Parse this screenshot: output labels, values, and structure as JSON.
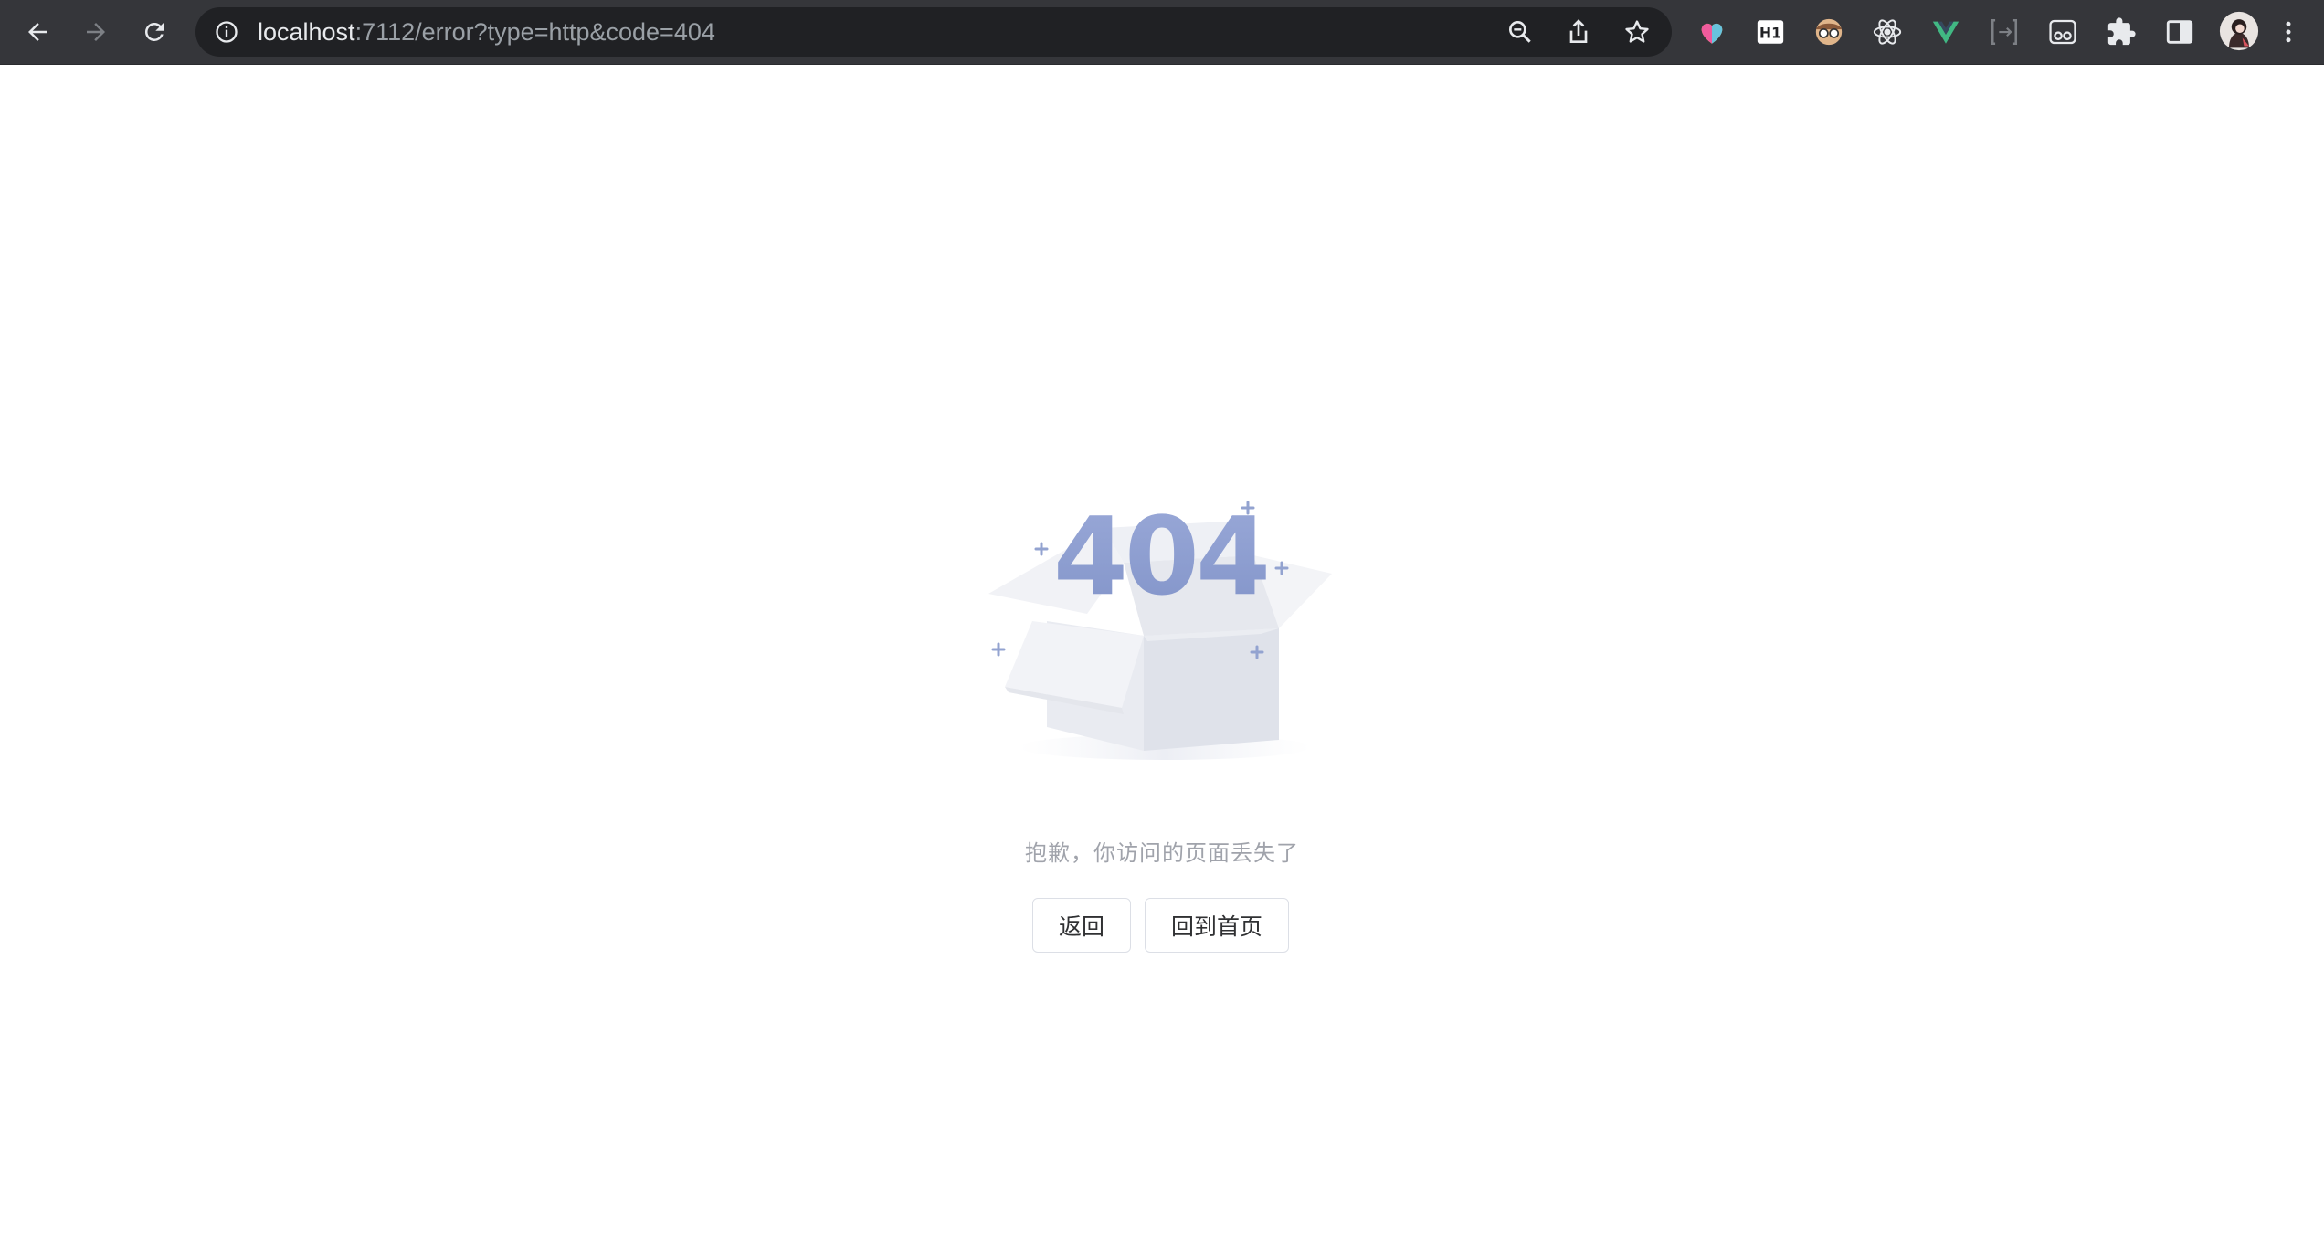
{
  "browser": {
    "url_host": "localhost",
    "url_rest": ":7112/error?type=http&code=404",
    "extensions": [
      "colorful-heart-icon",
      "h1-icon",
      "glasses-face-icon",
      "react-atom-icon",
      "vue-icon",
      "bracket-icon",
      "eyes-box-icon",
      "puzzle-icon",
      "side-panel-icon",
      "avatar"
    ]
  },
  "error": {
    "code": "404",
    "message": "抱歉，你访问的页面丢失了",
    "back_label": "返回",
    "home_label": "回到首页"
  },
  "colors": {
    "toolbar": "#35363a",
    "omnibox": "#202124",
    "accent": "#8fa0d2",
    "text_muted": "#a0a3ab"
  }
}
